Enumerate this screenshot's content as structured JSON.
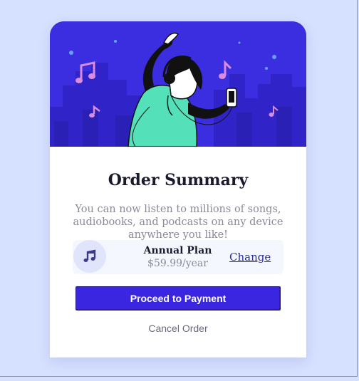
{
  "card": {
    "title": "Order Summary",
    "description": "You can now listen to millions of songs, audiobooks, and podcasts on any device anywhere you like!"
  },
  "plan": {
    "icon": "music-note-icon",
    "name": "Annual Plan",
    "price": "$59.99/year",
    "change_label": "Change"
  },
  "actions": {
    "proceed_label": "Proceed to Payment",
    "cancel_label": "Cancel Order"
  },
  "colors": {
    "page_background": "#d6e0ff",
    "hero_background": "#3a2ee0",
    "primary_button": "#3a25e0",
    "plan_background": "#f5f7ff"
  }
}
